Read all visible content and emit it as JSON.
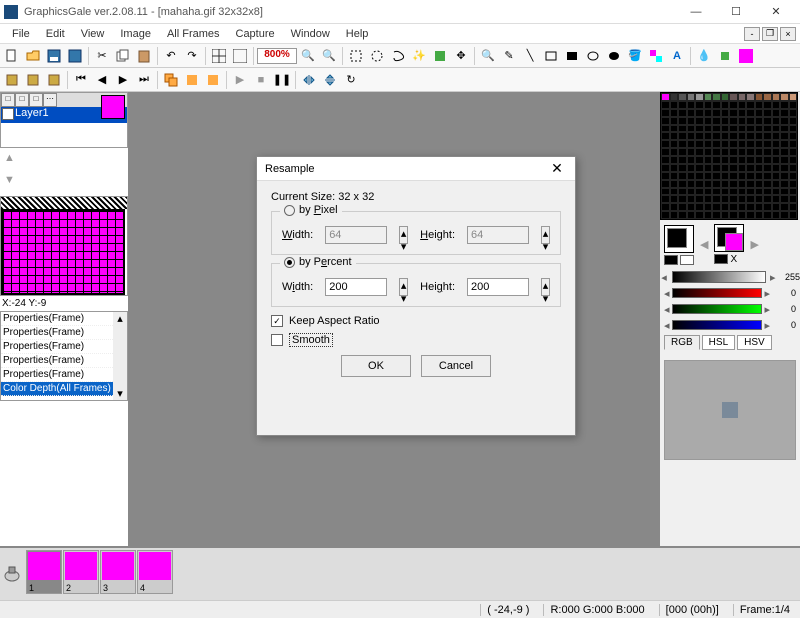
{
  "window": {
    "title": "GraphicsGale ver.2.08.11 - [mahaha.gif 32x32x8]",
    "min": "—",
    "max": "☐",
    "close": "✕"
  },
  "menu": [
    "File",
    "Edit",
    "View",
    "Image",
    "All Frames",
    "Capture",
    "Window",
    "Help"
  ],
  "zoom": "800%",
  "layer": {
    "name": "Layer1"
  },
  "coord": "X:-24 Y:-9",
  "history": {
    "items": [
      "Properties(Frame)",
      "Properties(Frame)",
      "Properties(Frame)",
      "Properties(Frame)",
      "Properties(Frame)",
      "Color Depth(All Frames)"
    ],
    "selected": 5
  },
  "gray_value": "255",
  "rgb": {
    "r": "0",
    "g": "0",
    "b": "0"
  },
  "color_tabs": [
    "RGB",
    "HSL",
    "HSV"
  ],
  "frames": [
    {
      "n": "1",
      "sel": true
    },
    {
      "n": "2"
    },
    {
      "n": "3"
    },
    {
      "n": "4"
    }
  ],
  "status": {
    "pos": "( -24,-9 )",
    "rgb": "R:000 G:000 B:000",
    "time": "[000 (00h)]",
    "frame": "Frame:1/4"
  },
  "dialog": {
    "title": "Resample",
    "current": "Current Size: 32 x 32",
    "by_pixel": "by Pixel",
    "by_percent": "by Percent",
    "width_l": "Width:",
    "height_l": "Height:",
    "px_w": "64",
    "px_h": "64",
    "pc_w": "200",
    "pc_h": "200",
    "keep_aspect": "Keep Aspect Ratio",
    "smooth": "Smooth",
    "ok": "OK",
    "cancel": "Cancel"
  }
}
